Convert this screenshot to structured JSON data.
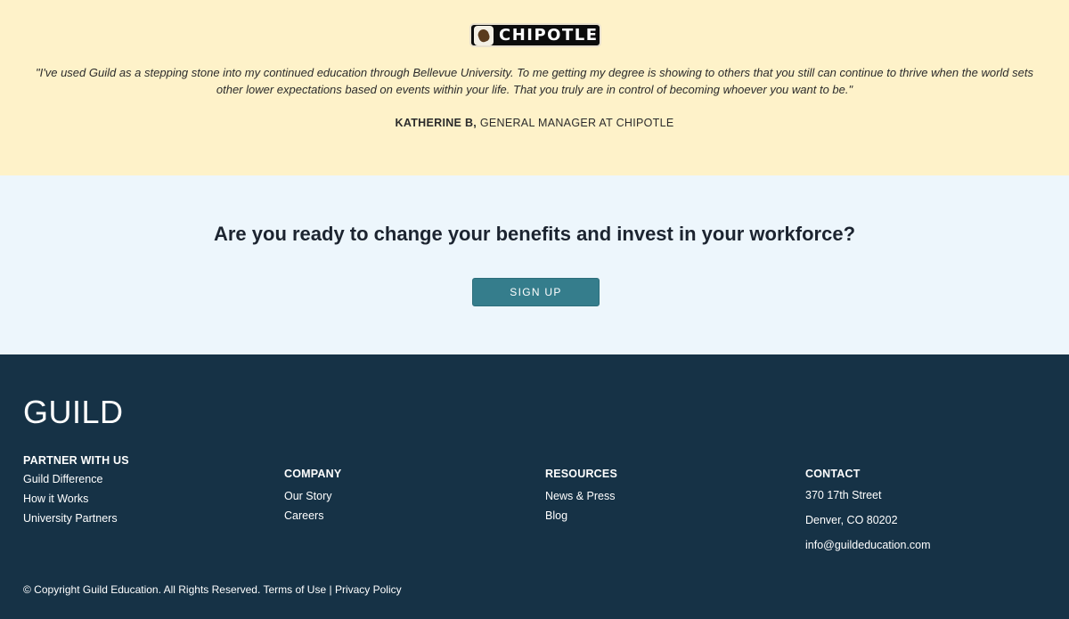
{
  "testimonial": {
    "logo_text": "CHIPOTLE",
    "quote": "\"I've used Guild as a stepping stone into my continued education through Bellevue University. To me getting my degree is showing to others that you still can continue to thrive when the world sets other lower expectations based on events within your life. That you truly are in control of becoming whoever you want to be.\"",
    "author": "KATHERINE B,",
    "role": "GENERAL MANAGER AT CHIPOTLE"
  },
  "cta": {
    "heading": "Are you ready to change your benefits and invest in your workforce?",
    "button_label": "SIGN UP"
  },
  "footer": {
    "logo": "GUILD",
    "partner": {
      "title": "PARTNER WITH US",
      "links": [
        "Guild Difference",
        "How it Works",
        "University Partners"
      ]
    },
    "company": {
      "title": "COMPANY",
      "links": [
        "Our Story",
        "Careers"
      ]
    },
    "resources": {
      "title": "RESOURCES",
      "links": [
        "News & Press",
        "Blog"
      ]
    },
    "contact": {
      "title": "CONTACT",
      "address_line1": "370 17th Street",
      "address_line2": "Denver, CO 80202",
      "email": "info@guildeducation.com"
    },
    "copyright": "© Copyright Guild Education. All Rights Reserved.",
    "terms": "Terms of Use",
    "separator": "|",
    "privacy": "Privacy Policy"
  },
  "colors": {
    "testimonial_bg": "#fef2c9",
    "cta_bg": "#edf6fc",
    "button_bg": "#357d8c",
    "footer_bg": "#163246"
  }
}
